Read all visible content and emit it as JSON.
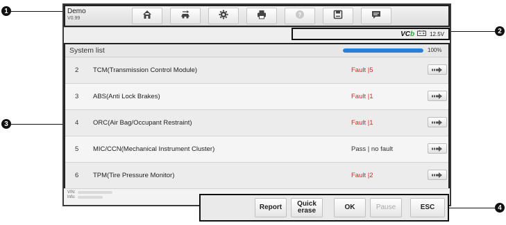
{
  "callouts": [
    "1",
    "2",
    "3",
    "4"
  ],
  "toolbar": {
    "app_title": "Demo",
    "version": "V0.99",
    "icons": [
      "home-icon",
      "vehicle-swap-icon",
      "gear-icon",
      "printer-icon",
      "help-icon",
      "save-icon",
      "chat-icon"
    ]
  },
  "status": {
    "vci_text": "VC",
    "vci_suffix": "b",
    "voltage": "12.5V",
    "accent_green": "#2ba339"
  },
  "system_list": {
    "title": "System list",
    "progress_percent": 100,
    "progress_label": "100%",
    "rows": [
      {
        "num": "2",
        "name": "TCM(Transmission Control Module)",
        "status": "Fault |5",
        "status_kind": "fault"
      },
      {
        "num": "3",
        "name": "ABS(Anti Lock Brakes)",
        "status": "Fault |1",
        "status_kind": "fault"
      },
      {
        "num": "4",
        "name": "ORC(Air Bag/Occupant Restraint)",
        "status": "Fault |1",
        "status_kind": "fault"
      },
      {
        "num": "5",
        "name": "MIC/CCN(Mechanical Instrument Cluster)",
        "status": "Pass | no fault",
        "status_kind": "pass"
      },
      {
        "num": "6",
        "name": "TPM(Tire Pressure Monitor)",
        "status": "Fault |2",
        "status_kind": "fault"
      }
    ]
  },
  "footer": {
    "vin_label": "VIN:",
    "info_label": "Info:"
  },
  "actions": {
    "report": "Report",
    "quick_erase": "Quick\nerase",
    "ok": "OK",
    "pause": "Pause",
    "esc": "ESC"
  },
  "colors": {
    "fault": "#e02020",
    "progress": "#2b7fd6"
  }
}
